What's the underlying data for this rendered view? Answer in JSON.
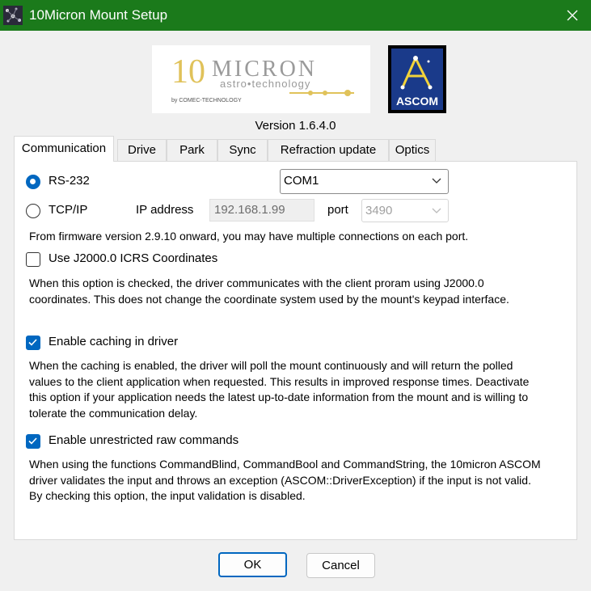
{
  "window": {
    "title": "10Micron Mount Setup",
    "title_bar_color": "#1b7a1b"
  },
  "logos": {
    "micron_text": "MICRON",
    "micron_number": "10",
    "micron_tagline": "astro•technology",
    "micron_byline": "by COMEC-TECHNOLOGY",
    "ascom_text": "ASCOM"
  },
  "version": "Version 1.6.4.0",
  "tabs": [
    {
      "label": "Communication",
      "active": true
    },
    {
      "label": "Drive"
    },
    {
      "label": "Park"
    },
    {
      "label": "Sync"
    },
    {
      "label": "Refraction update"
    },
    {
      "label": "Optics"
    }
  ],
  "communication": {
    "rs232_label": "RS-232",
    "com_port": "COM1",
    "tcpip_label": "TCP/IP",
    "ip_label": "IP address",
    "ip_value": "192.168.1.99",
    "port_label": "port",
    "port_value": "3490",
    "firmware_note": "From firmware version 2.9.10 onward, you may have multiple connections on each port.",
    "j2000_label": "Use J2000.0 ICRS Coordinates",
    "j2000_desc": "When this option is checked, the driver communicates with the client proram using J2000.0 coordinates. This does not change the coordinate system used by the mount's keypad interface.",
    "caching_label": "Enable caching in driver",
    "caching_desc": "When the caching is enabled, the driver will poll the mount continuously and will return the polled values to the client application when requested. This results in improved response times. Deactivate this option if your application needs the latest up-to-date information from the mount and is willing to tolerate the communication delay.",
    "raw_label": "Enable unrestricted raw commands",
    "raw_desc": "When using the functions CommandBlind, CommandBool and CommandString, the 10micron ASCOM driver validates the input and throws an exception (ASCOM::DriverException) if the input is not valid. By checking this option, the input validation is disabled."
  },
  "buttons": {
    "ok": "OK",
    "cancel": "Cancel"
  },
  "accent_color": "#0067c0"
}
